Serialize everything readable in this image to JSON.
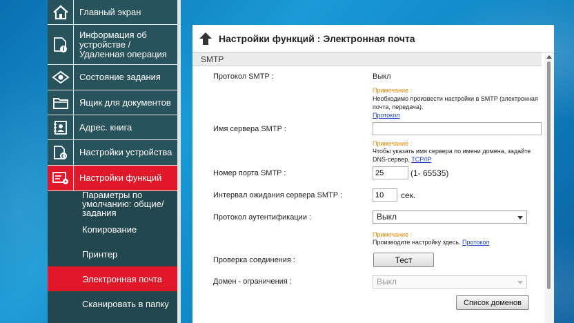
{
  "sidebar": {
    "items": [
      {
        "label": "Главный экран",
        "icon": "home-icon"
      },
      {
        "label": "Информация об устройстве / Удаленная операция",
        "icon": "device-info-icon"
      },
      {
        "label": "Состояние задания",
        "icon": "eye-icon"
      },
      {
        "label": "Ящик для документов",
        "icon": "folder-icon"
      },
      {
        "label": "Адрес. книга",
        "icon": "address-book-icon"
      },
      {
        "label": "Настройки устройства",
        "icon": "device-settings-icon"
      },
      {
        "label": "Настройки функций",
        "icon": "function-settings-icon"
      }
    ],
    "sub_items": [
      {
        "label": "Параметры по умолчанию: общие/задания"
      },
      {
        "label": "Копирование"
      },
      {
        "label": "Принтер"
      },
      {
        "label": "Электронная почта"
      },
      {
        "label": "Сканировать в папку"
      }
    ]
  },
  "panel": {
    "title": "Настройки функций : Электронная почта",
    "section": "SMTP",
    "smtp_protocol": {
      "label": "Протокол SMTP :",
      "value": "Выкл",
      "note_title": "Примечание :",
      "note_text": "Необходимо произвести настройки в SMTP (электронная почта, передача).",
      "note_link": "Протокол"
    },
    "smtp_server": {
      "label": "Имя сервера SMTP :",
      "value": "",
      "note_title": "Примечание :",
      "note_text": "Чтобы указать имя сервера по имени домена, задайте DNS-сервер.",
      "note_link": "TCP/IP"
    },
    "smtp_port": {
      "label": "Номер порта SMTP :",
      "value": "25",
      "range": "(1- 65535)"
    },
    "smtp_timeout": {
      "label": "Интервал ожидания сервера SMTP :",
      "value": "10",
      "unit": "сек."
    },
    "auth_protocol": {
      "label": "Протокол аутентификации :",
      "value": "Выкл",
      "note_title": "Примечание :",
      "note_text": "Производите настройку здесь.",
      "note_link": "Протокол"
    },
    "connection_test": {
      "label": "Проверка соединения :",
      "button": "Тест"
    },
    "domain_restriction": {
      "label": "Домен - ограничения :",
      "value": "Выкл",
      "button": "Список доменов"
    }
  },
  "colors": {
    "sidebar_bg": "#22474f",
    "sidebar_item_bg": "#28535c",
    "active_red": "#e0182a",
    "note_orange": "#e08a00",
    "link_blue": "#1a3cc8"
  }
}
